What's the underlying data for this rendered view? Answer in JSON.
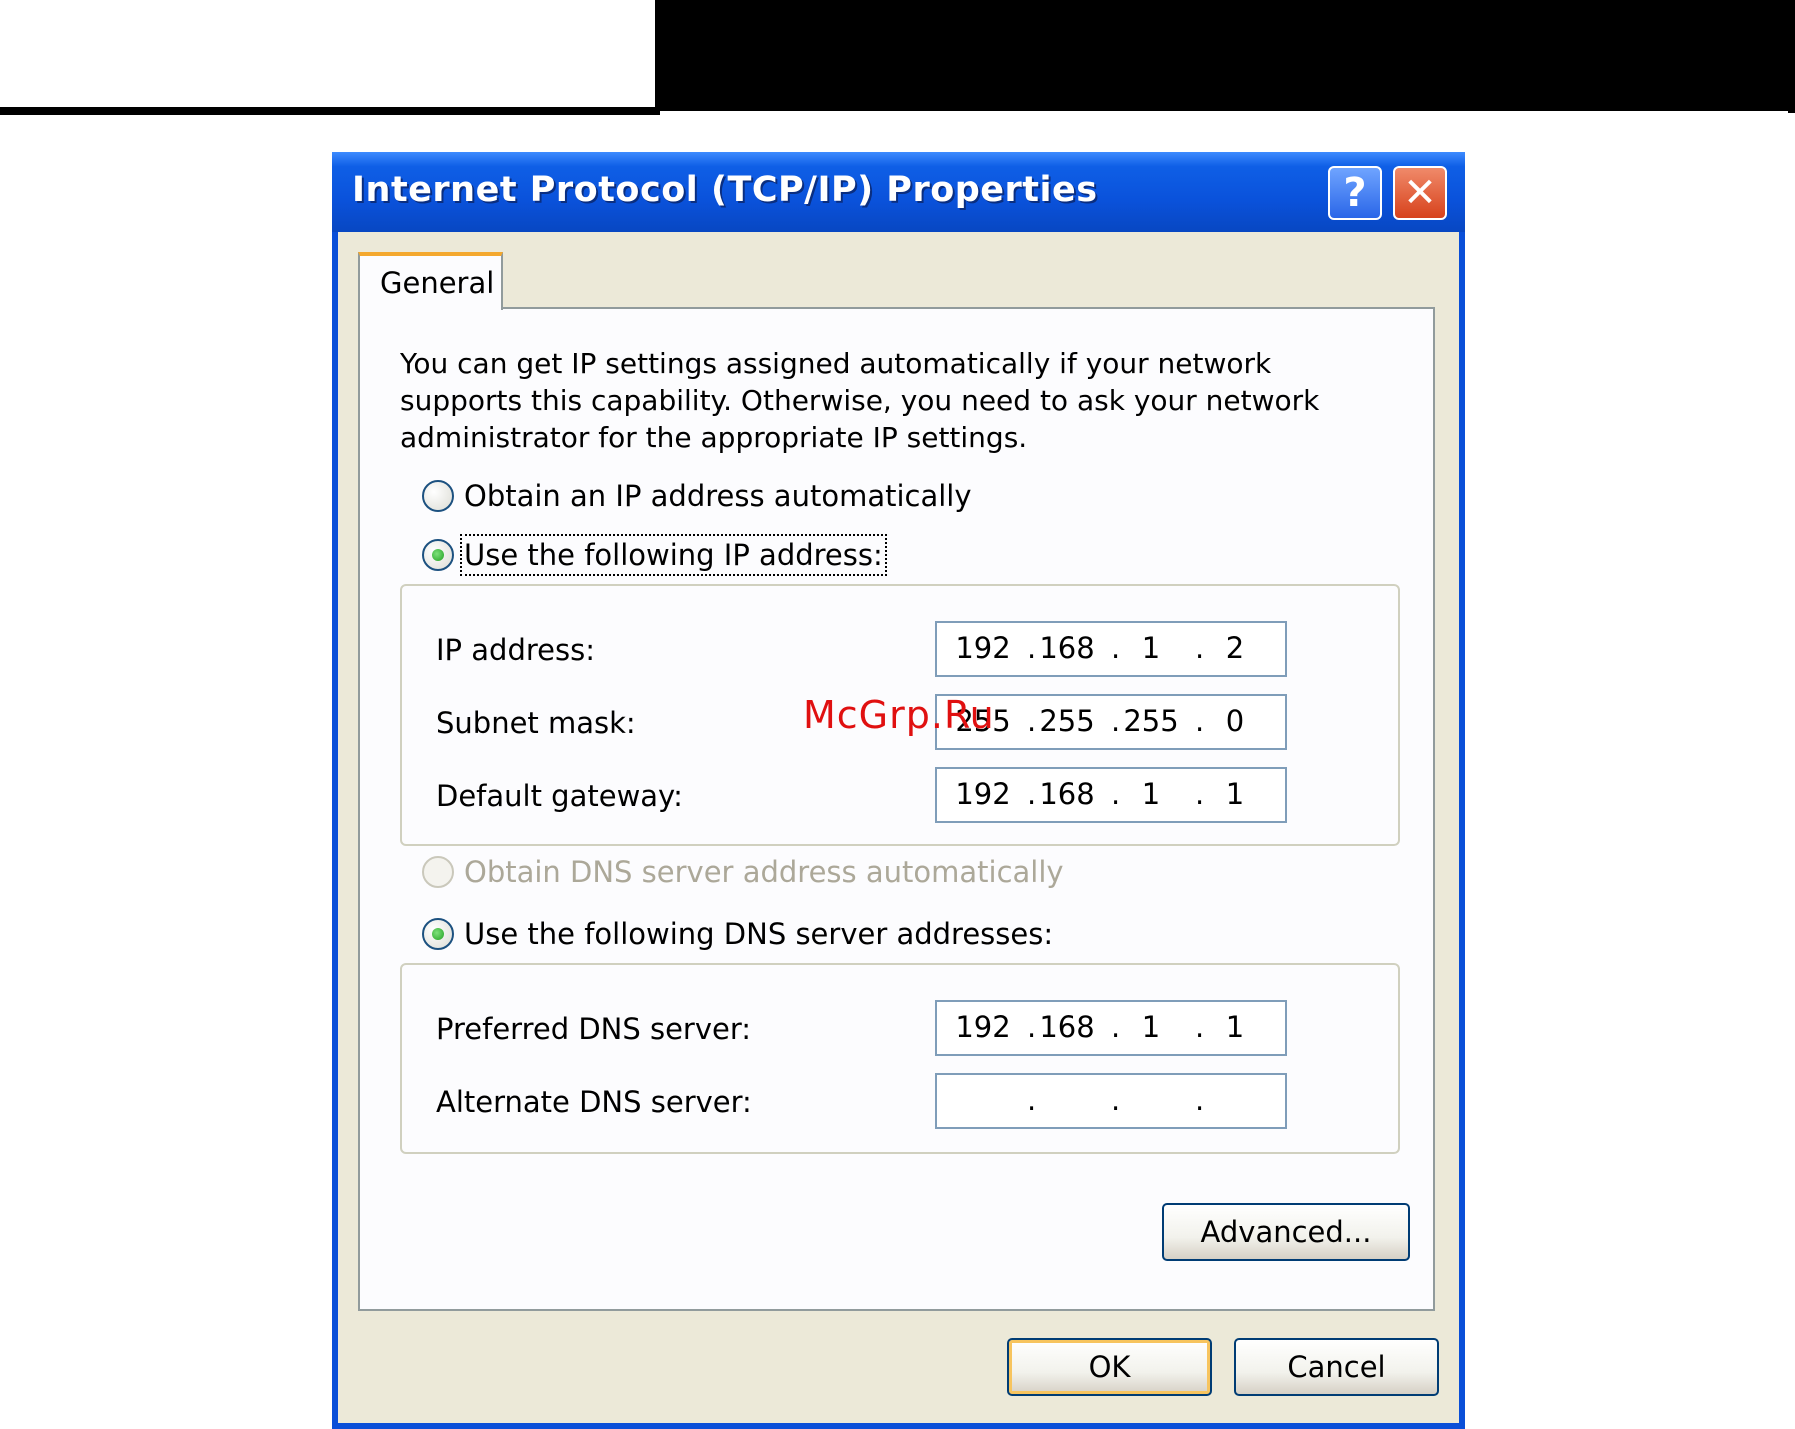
{
  "window": {
    "title": "Internet Protocol (TCP/IP) Properties",
    "help_label": "?",
    "close_label": "✕"
  },
  "tabs": [
    {
      "label": "General",
      "selected": true
    }
  ],
  "description": "You can get IP settings assigned automatically if your network supports this capability. Otherwise, you need to ask your network administrator for the appropriate IP settings.",
  "ip_mode": {
    "auto_label": "Obtain an IP address automatically",
    "manual_label": "Use the following IP address:",
    "selected": "manual"
  },
  "ip_fields": {
    "ip_address": {
      "label": "IP address:",
      "octets": [
        "192",
        "168",
        "1",
        "2"
      ]
    },
    "subnet_mask": {
      "label": "Subnet mask:",
      "octets": [
        "255",
        "255",
        "255",
        "0"
      ]
    },
    "default_gateway": {
      "label": "Default gateway:",
      "octets": [
        "192",
        "168",
        "1",
        "1"
      ]
    }
  },
  "dns_mode": {
    "auto_label": "Obtain DNS server address automatically",
    "manual_label": "Use the following DNS server addresses:",
    "selected": "manual",
    "auto_disabled": true
  },
  "dns_fields": {
    "preferred": {
      "label": "Preferred DNS server:",
      "octets": [
        "192",
        "168",
        "1",
        "1"
      ]
    },
    "alternate": {
      "label": "Alternate DNS server:",
      "octets": [
        "",
        "",
        "",
        ""
      ]
    }
  },
  "buttons": {
    "advanced": "Advanced...",
    "ok": "OK",
    "cancel": "Cancel"
  },
  "watermark": "McGrp.Ru",
  "colors": {
    "titlebar": "#0a52db",
    "dialog_bg": "#ece9d8",
    "tab_accent": "#f4a82e",
    "radio_checked": "#21a121",
    "watermark": "#e01010"
  }
}
